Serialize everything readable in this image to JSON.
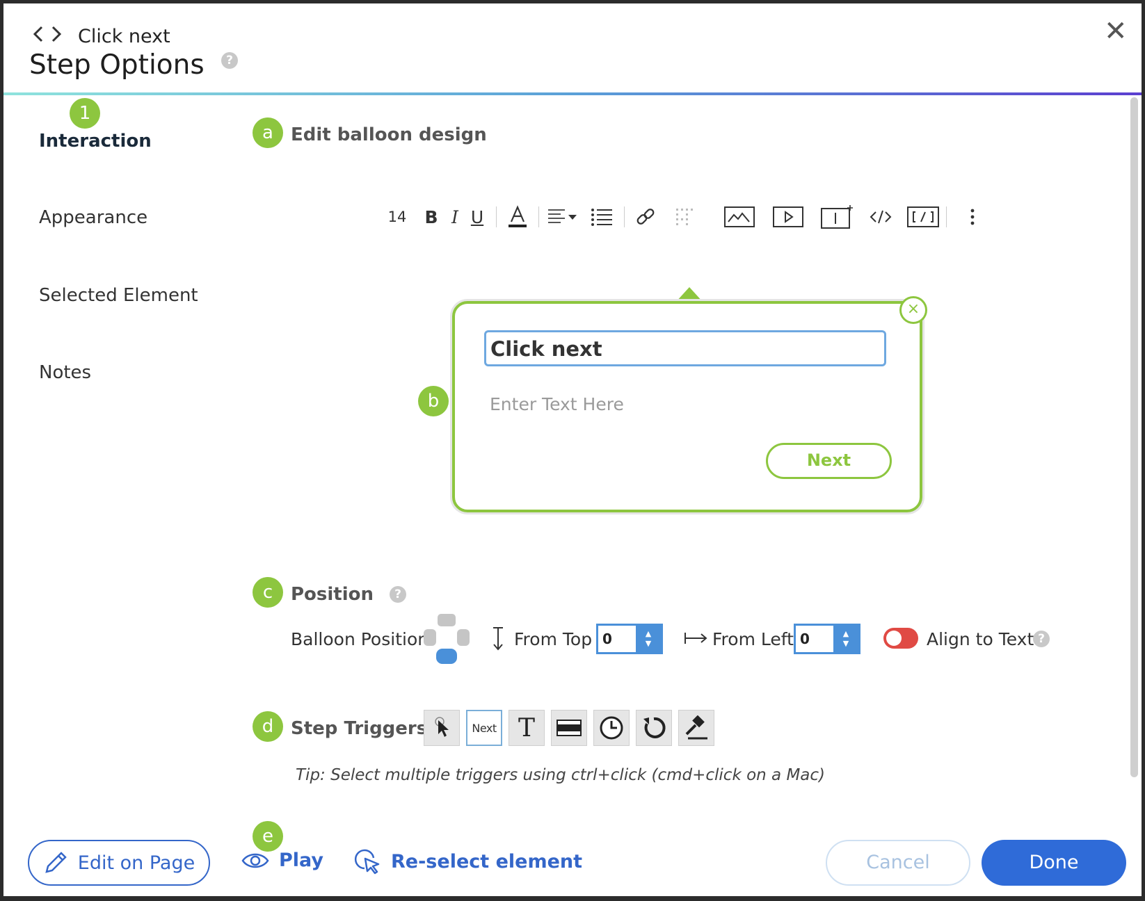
{
  "header": {
    "breadcrumb": "Click next",
    "title": "Step Options",
    "help_glyph": "?",
    "close_glyph": "✕"
  },
  "sidebar": {
    "items": [
      {
        "label": "Interaction",
        "badge": "1",
        "active": true
      },
      {
        "label": "Appearance"
      },
      {
        "label": "Selected Element"
      },
      {
        "label": "Notes"
      }
    ]
  },
  "sections": {
    "balloon_design": {
      "badge": "a",
      "title": "Edit balloon design"
    },
    "balloon_preview": {
      "badge": "b"
    },
    "position": {
      "badge": "c",
      "title": "Position"
    },
    "triggers": {
      "badge": "d",
      "title": "Step Triggers"
    },
    "footer_badge": "e"
  },
  "toolbar": {
    "font_size": "14",
    "bold": "B",
    "italic": "I",
    "underline": "U",
    "icons": [
      "font-color-icon",
      "align-icon",
      "list-icon",
      "link-icon",
      "unlink-icon",
      "image-icon",
      "video-icon",
      "text-box-icon",
      "code-icon",
      "embed-icon",
      "more-icon"
    ]
  },
  "balloon": {
    "title_value": "Click next",
    "body_placeholder": "Enter Text Here",
    "next_label": "Next",
    "close_glyph": "×",
    "accent_color": "#8dc63f"
  },
  "position": {
    "balloon_position_label": "Balloon Position",
    "from_top_label": "From Top",
    "from_top_value": "0",
    "from_left_label": "From Left",
    "from_left_value": "0",
    "align_to_text_label": "Align to Text",
    "align_to_text_on": false
  },
  "triggers": {
    "next_label": "Next",
    "text_label": "T",
    "items": [
      "click-element-icon",
      "next-button",
      "text-icon",
      "bar-icon",
      "clock-icon",
      "refresh-icon",
      "hammer-icon"
    ],
    "tip": "Tip: Select multiple triggers using ctrl+click (cmd+click on a Mac)"
  },
  "footer": {
    "edit_on_page": "Edit on Page",
    "play": "Play",
    "reselect": "Re-select element",
    "cancel": "Cancel",
    "done": "Done"
  },
  "colors": {
    "accent_green": "#8dc63f",
    "primary_blue": "#2f6bd8",
    "link_blue": "#3466c9",
    "toggle_off_red": "#e04a44"
  }
}
